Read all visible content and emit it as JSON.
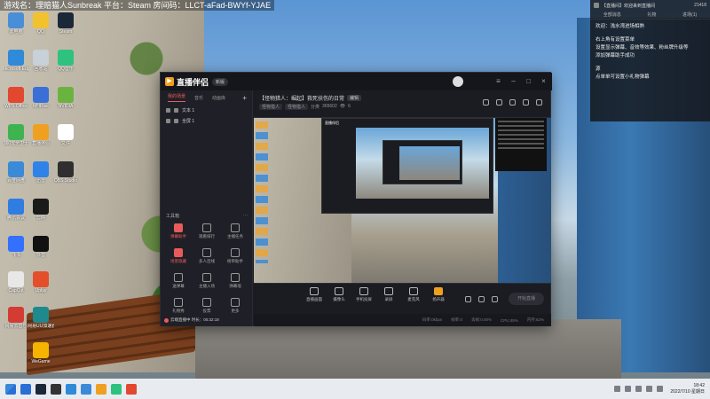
{
  "overlay_top": {
    "text": "游戏名：理赔猫人Sunbreak  平台：Steam  房间码：LLCT-aFad-BWYf-YJAE"
  },
  "desktop": {
    "icons": [
      {
        "label": "此电脑",
        "color": "#4a8ed8"
      },
      {
        "label": "QQ",
        "color": "#f2c12e"
      },
      {
        "label": "Steam",
        "color": "#1b2838"
      },
      {
        "label": "Microsoft Edge",
        "color": "#2f8ad8"
      },
      {
        "label": "回收站",
        "color": "#c8d0d8"
      },
      {
        "label": "QQ音乐",
        "color": "#2ec27e"
      },
      {
        "label": "WPS Office",
        "color": "#e2472f"
      },
      {
        "label": "MHRise",
        "color": "#3a6fd8"
      },
      {
        "label": "NVIDIA",
        "color": "#6bb33f"
      },
      {
        "label": "360安全卫士",
        "color": "#3fb34f"
      },
      {
        "label": "直播伴侣",
        "color": "#f0a020"
      },
      {
        "label": "文件",
        "color": "#ffffff"
      },
      {
        "label": "百度网盘",
        "color": "#3a8ad8"
      },
      {
        "label": "迅雷",
        "color": "#2e82e8"
      },
      {
        "label": "OBS Studio",
        "color": "#302e31"
      },
      {
        "label": "腾讯会议",
        "color": "#2f7de1"
      },
      {
        "label": "剪映",
        "color": "#1a1a1a"
      },
      {
        "label": "飞书",
        "color": "#3370ff"
      },
      {
        "label": "抖音",
        "color": "#111111"
      },
      {
        "label": "CapCut",
        "color": "#e8e8e8"
      },
      {
        "label": "Uplay",
        "color": "#e34f2a"
      },
      {
        "label": "网易云音乐",
        "color": "#d43c33"
      },
      {
        "label": "网易UU加速器",
        "color": "#1e8a8e"
      },
      {
        "label": "WeGame",
        "color": "#f5b400"
      }
    ]
  },
  "app": {
    "logo_text": "直播伴侣",
    "version_badge": "新版",
    "window_controls": [
      "–",
      "□",
      "×"
    ],
    "sidebar": {
      "tabs": [
        "我的场景",
        "音乐",
        "动画库"
      ],
      "plus": "+",
      "scenes": [
        "文本 1",
        "全屏 1"
      ],
      "tools_header": "工具箱",
      "tools_more": "···",
      "tools": [
        {
          "label": "弹幕助手",
          "highlight": true
        },
        {
          "label": "观看排行",
          "highlight": false
        },
        {
          "label": "主播任务",
          "highlight": false
        },
        {
          "label": "场景隐藏",
          "highlight": true
        },
        {
          "label": "多人连线",
          "highlight": false
        },
        {
          "label": "榜单助手",
          "highlight": false
        },
        {
          "label": "送弹幕",
          "highlight": false
        },
        {
          "label": "主播入场",
          "highlight": false
        },
        {
          "label": "弹幕墙",
          "highlight": false
        },
        {
          "label": "礼物秀",
          "highlight": false
        },
        {
          "label": "投票",
          "highlight": false
        },
        {
          "label": "更多",
          "highlight": false
        }
      ],
      "footer": "云端直播中 时长：00:32:18"
    },
    "room": {
      "title": "【怪物猎人：崛起】救死扶伤的日常",
      "title_tag": "编辑",
      "chips": [
        "怪物猎人",
        "怪物猎人",
        "分类",
        "365602"
      ],
      "viewers": "6"
    },
    "nested_preview_title": "直播伴侣",
    "bottom_tools": [
      {
        "label": "直播画面",
        "accent": false
      },
      {
        "label": "摄像头",
        "accent": false
      },
      {
        "label": "手机投屏",
        "accent": false
      },
      {
        "label": "录屏",
        "accent": false
      },
      {
        "label": "麦克风",
        "accent": false
      },
      {
        "label": "扬声器",
        "accent": true
      }
    ],
    "start_button": "开始直播",
    "status": [
      "码率:0kbps",
      "帧率:0",
      "丢帧:0.00%",
      "CPU:45%",
      "内存:62%"
    ]
  },
  "chat": {
    "header_title": "【直播间】欢迎来到直播间",
    "header_count": "21418",
    "tabs": [
      "全部消息",
      "礼物",
      "进场(1)"
    ],
    "lines": [
      "欢迎：浅水湾进场相熟",
      "",
      "右上角有设置菜单",
      "设置显示弹幕、音效等效果、粉丝牌升级等",
      "添加弹幕助手成功",
      "",
      "源",
      "点单单可设置小礼物弹幕"
    ]
  },
  "taskbar": {
    "apps": [
      "#2a6fd6",
      "#1b2838",
      "#333333",
      "#2f8ad8",
      "#3a8ad8",
      "#f0a020",
      "#2ec27e",
      "#e2472f"
    ],
    "time": "18:42",
    "date": "2022/7/10 星期日"
  }
}
